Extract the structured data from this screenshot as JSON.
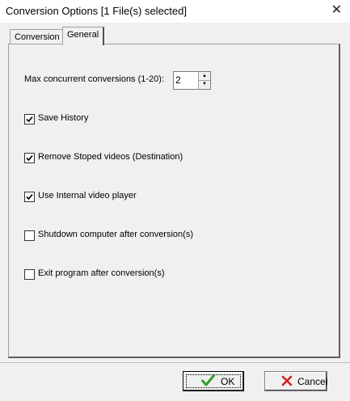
{
  "window": {
    "title": "Conversion Options [1 File(s) selected]",
    "close_glyph": "✕"
  },
  "tabs": [
    {
      "label": "Conversion",
      "active": false
    },
    {
      "label": "General",
      "active": true
    }
  ],
  "general": {
    "max_concurrent_label": "Max concurrent conversions (1-20):",
    "max_concurrent_value": "2",
    "options": [
      {
        "label": "Save History",
        "checked": true
      },
      {
        "label": "Remove Stoped videos (Destination)",
        "checked": true
      },
      {
        "label": "Use Internal video player",
        "checked": true
      },
      {
        "label": "Shutdown computer after conversion(s)",
        "checked": false
      },
      {
        "label": "Exit program after conversion(s)",
        "checked": false
      }
    ]
  },
  "buttons": {
    "ok_label": "OK",
    "ok_icon": "green-checkmark-icon",
    "cancel_label": "Cancel",
    "cancel_icon": "red-x-icon"
  },
  "colors": {
    "ok_icon": "#2e9e2e",
    "cancel_icon": "#d32020"
  }
}
